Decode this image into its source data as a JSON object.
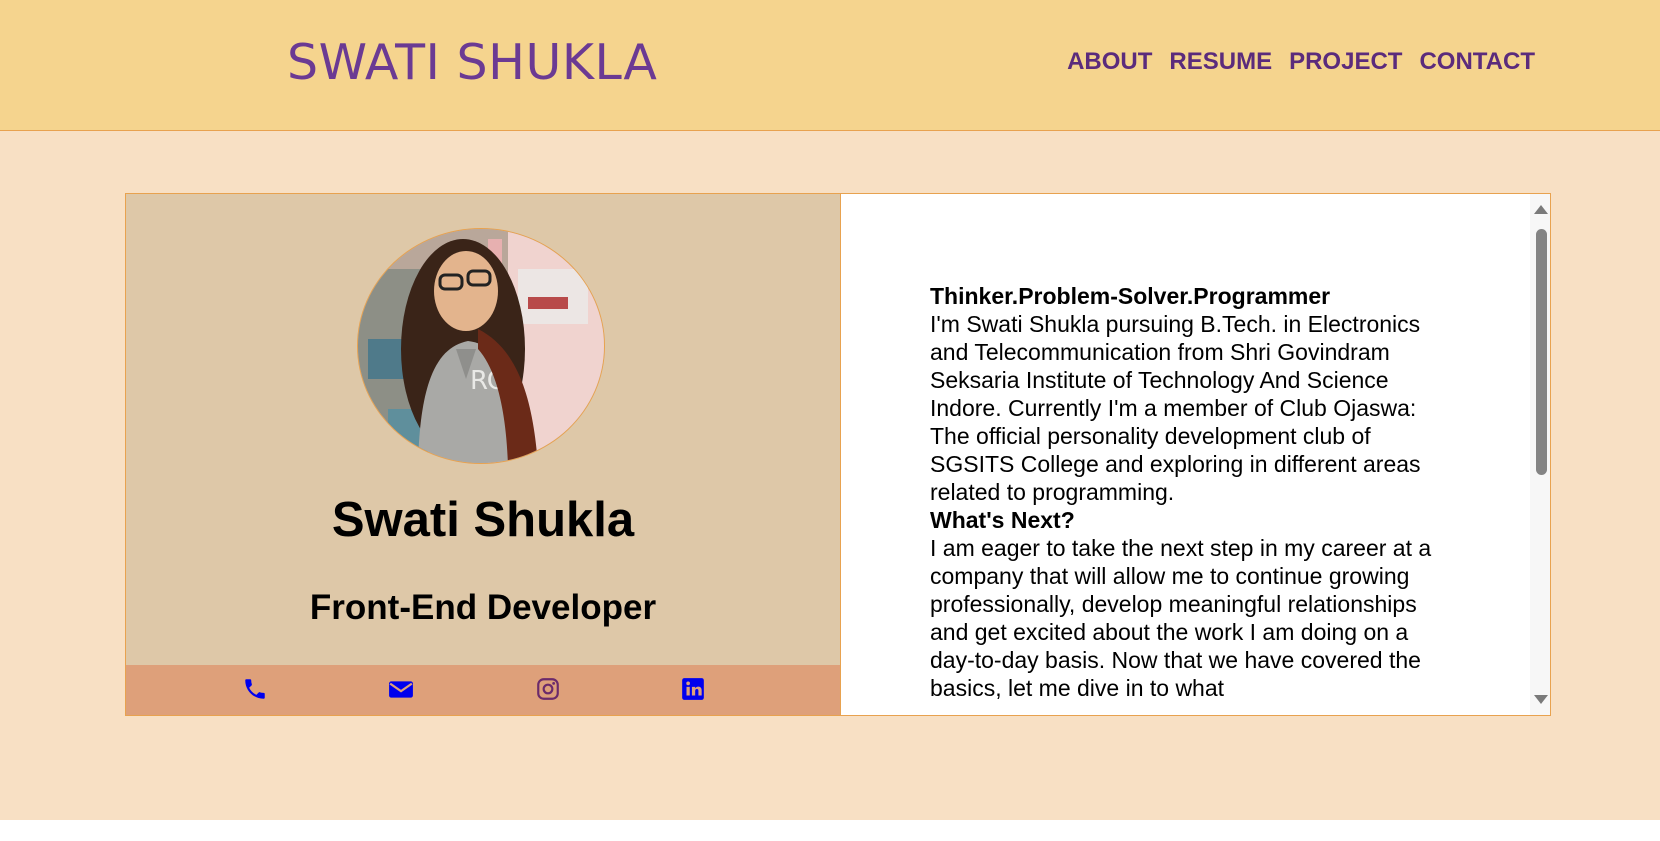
{
  "header": {
    "brand": "SWATI SHUKLA",
    "nav": [
      "ABOUT",
      "RESUME",
      "PROJECT",
      "CONTACT"
    ]
  },
  "profile": {
    "name": "Swati Shukla",
    "role": "Front-End Developer",
    "contact_icons": [
      "phone-icon",
      "mail-icon",
      "instagram-icon",
      "linkedin-icon"
    ]
  },
  "about": {
    "tagline": "Thinker.Problem-Solver.Programmer",
    "intro": "I'm Swati Shukla pursuing B.Tech. in Electronics and Telecommunication from Shri Govindram Seksaria Institute of Technology And Science Indore. Currently I'm a member of Club Ojaswa: The official personality development club of SGSITS College and exploring in different areas related to programming.",
    "next_heading": "What's Next?",
    "next_text": "I am eager to take the next step in my career at a company that will allow me to continue growing professionally, develop meaningful relationships and get excited about the work I am doing on a day-to-day basis. Now that we have covered the basics, let me dive in to what"
  },
  "colors": {
    "header_bg": "#f5d48e",
    "brand": "#6b3a93",
    "nav": "#5b2b7c",
    "page_bg": "#f8e0c4",
    "left_panel": "#dec8a8",
    "contact_bar": "#dea07a",
    "icon": "#0000ee",
    "border": "#e8a24f"
  }
}
